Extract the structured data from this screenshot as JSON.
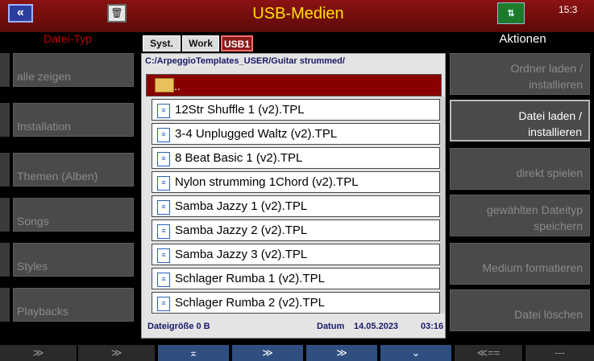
{
  "header": {
    "back_label": "«",
    "trash_label": "🗑",
    "title": "USB-Medien",
    "usb_label": "⇅",
    "clock": "15:3"
  },
  "left": {
    "header": "Datei-Typ",
    "items": [
      "alle zeigen",
      "Installation",
      "Themen (Alben)",
      "Songs",
      "Styles",
      "Playbacks"
    ]
  },
  "tabs": [
    "Syst.",
    "Work",
    "USB1"
  ],
  "browser": {
    "path": "C:/ArpeggioTemplates_USER/Guitar strummed/",
    "parent": "..",
    "files": [
      "12Str Shuffle 1 (v2).TPL",
      "3-4 Unplugged Waltz (v2).TPL",
      "8 Beat Basic 1 (v2).TPL",
      "Nylon strumming 1Chord (v2).TPL",
      "Samba Jazzy 1 (v2).TPL",
      "Samba Jazzy 2 (v2).TPL",
      "Samba Jazzy 3 (v2).TPL",
      "Schlager Rumba 1 (v2).TPL",
      "Schlager Rumba 2 (v2).TPL"
    ],
    "size_text": "Dateigröße 0 B",
    "date_label": "Datum",
    "date": "14.05.2023",
    "time": "03:16"
  },
  "right": {
    "header": "Aktionen",
    "items": [
      {
        "line1": "Ordner laden /",
        "line2": "installieren"
      },
      {
        "line1": "Datei laden /",
        "line2": "installieren"
      },
      {
        "line1": "direkt spielen",
        "line2": ""
      },
      {
        "line1": "gewählten Dateityp",
        "line2": "speichern"
      },
      {
        "line1": "Medium formatieren",
        "line2": ""
      },
      {
        "line1": "Datei löschen",
        "line2": ""
      }
    ],
    "active_index": 1
  },
  "bottom": [
    "≫",
    "≫",
    "⌅",
    "≫",
    "≫",
    "⌄",
    "≪==",
    "---"
  ]
}
